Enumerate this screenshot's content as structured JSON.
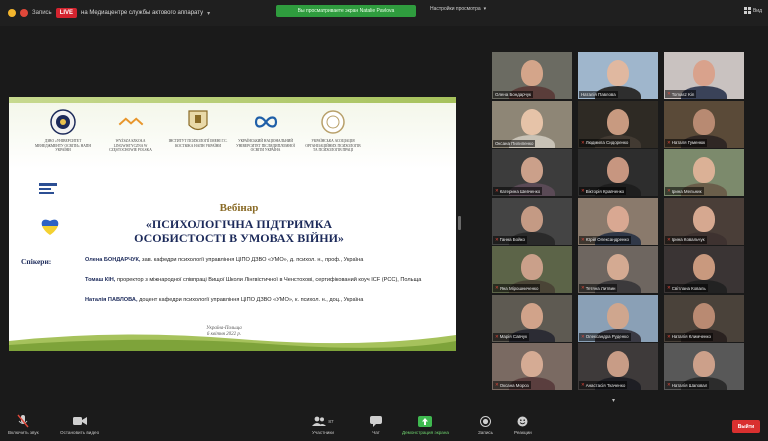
{
  "topbar": {
    "live_label": "LIVE",
    "recording_label": "Запись",
    "channel": "на Медиацентре службы актового аппарату",
    "banner": "Вы просматриваете экран Natalie Pavlova",
    "view_options": "Настройки просмотра",
    "view_button": "Вид"
  },
  "slide": {
    "logos": [
      {
        "caption": "ДЗВО «УНІВЕРСИТЕТ МЕНЕДЖМЕНТУ ОСВІТИ» НАПН УКРАЇНИ"
      },
      {
        "caption": "WYŻSZA SZKOŁA LINGWISTYCZNA W CZĘSTOCHOWIE POLSKA"
      },
      {
        "caption": "ІНСТИТУТ ПСИХОЛОГІЇ ІМЕНІ Г.С. КОСТЮКА НАПН УКРАЇНИ"
      },
      {
        "caption": "УКРАЇНСЬКИЙ НАЦІОНАЛЬНИЙ УНІВЕРСИТЕТ ПІСЛЯДИПЛОМНОЇ ОСВІТИ УКРАЇНА"
      },
      {
        "caption": "УКРАЇНСЬКА АСОЦІАЦІЯ ОРГАНІЗАЦІЙНИХ ПСИХОЛОГІВ ТА ПСИХОЛОГІВ ПРАЦІ"
      }
    ],
    "heading": "Вебінар",
    "title_line1": "«ПСИХОЛОГІЧНА ПІДТРИМКА",
    "title_line2": "ОСОБИСТОСТІ В УМОВАХ ВІЙНИ»",
    "speakers_label": "Спікери:",
    "speakers": [
      {
        "name": "Олена БОНДАРЧУК,",
        "desc": "зав. кафедри психології управління ЦІПО ДЗВО «УМО», д. психол. н., проф., Україна"
      },
      {
        "name": "Томаш КІН,",
        "desc": "проректор з міжнародної співпраці Вищої Школи Лінгвістичної в Ченстохові, сертифікований коуч ICF (PCC), Польща"
      },
      {
        "name": "Наталія ПАВЛОВА,",
        "desc": "доцент кафедри психології управління ЦІПО ДЗВО «УМО», к. психол. н., доц., Україна"
      }
    ],
    "place": "Україна-Польща",
    "date": "6 квітня 2022 р."
  },
  "gallery": [
    {
      "name": "Олена Бондарчук",
      "muted": false,
      "active": false,
      "bg": "#6b6b62",
      "skin": "#d4a58a",
      "cloth": "#5a3d3a"
    },
    {
      "name": "Наталія Павлова",
      "muted": false,
      "active": false,
      "bg": "#9fb6cc",
      "skin": "#e0b8a0",
      "cloth": "#2e2e2e"
    },
    {
      "name": "Tomasz Kin",
      "muted": true,
      "active": false,
      "bg": "#c9c2c0",
      "skin": "#d9a28c",
      "cloth": "#3a4258"
    },
    {
      "name": "Оксана Пилипенко",
      "muted": false,
      "active": true,
      "bg": "#8e8676",
      "skin": "#e6c3a8",
      "cloth": "#c8c2b6"
    },
    {
      "name": "Людмила Сидоренко",
      "muted": true,
      "active": false,
      "bg": "#2e2a24",
      "skin": "#c89a80",
      "cloth": "#423a32"
    },
    {
      "name": "Наталя Гуменюк",
      "muted": true,
      "active": false,
      "bg": "#5a4a38",
      "skin": "#b88a72",
      "cloth": "#2f2724"
    },
    {
      "name": "Катерина Шевченко",
      "muted": true,
      "active": false,
      "bg": "#3c3c3c",
      "skin": "#cba08a",
      "cloth": "#5a4a56"
    },
    {
      "name": "Вікторія Кравченко",
      "muted": true,
      "active": false,
      "bg": "#2d2d2d",
      "skin": "#c79680",
      "cloth": "#1e1e1e"
    },
    {
      "name": "Ірина Мельник",
      "muted": true,
      "active": false,
      "bg": "#7c8a6c",
      "skin": "#dbb196",
      "cloth": "#6a5e4a"
    },
    {
      "name": "Ганна Бойко",
      "muted": true,
      "active": false,
      "bg": "#444",
      "skin": "#c49a84",
      "cloth": "#2a2a2a"
    },
    {
      "name": "Юрій Олександренко",
      "muted": true,
      "active": false,
      "bg": "#8a7a6c",
      "skin": "#d9a892",
      "cloth": "#303848"
    },
    {
      "name": "Ірина Ковальчук",
      "muted": true,
      "active": false,
      "bg": "#4a3e38",
      "skin": "#d6a890",
      "cloth": "#3e3230"
    },
    {
      "name": "Яна Мірошниченко",
      "muted": true,
      "active": false,
      "bg": "#5c6448",
      "skin": "#caa08a",
      "cloth": "#4a4436"
    },
    {
      "name": "Тетяна Литвин",
      "muted": true,
      "active": false,
      "bg": "#6e6660",
      "skin": "#d4aa92",
      "cloth": "#3c3a3c"
    },
    {
      "name": "Світлана Коваль",
      "muted": true,
      "active": false,
      "bg": "#3a3434",
      "skin": "#c9997e",
      "cloth": "#222"
    },
    {
      "name": "Марія Савчук",
      "muted": true,
      "active": false,
      "bg": "#5e5a52",
      "skin": "#d1a38a",
      "cloth": "#2c2c34"
    },
    {
      "name": "Олександра Руденко",
      "muted": true,
      "active": false,
      "bg": "#8aa0b6",
      "skin": "#cfa68e",
      "cloth": "#3a3a44"
    },
    {
      "name": "Наталія Климченко",
      "muted": true,
      "active": false,
      "bg": "#4a423a",
      "skin": "#b98a72",
      "cloth": "#2a2220"
    },
    {
      "name": "Оксана Мороз",
      "muted": true,
      "active": false,
      "bg": "#7a6a62",
      "skin": "#d5ab94",
      "cloth": "#5a3e3e"
    },
    {
      "name": "Анастасія Ткаченко",
      "muted": true,
      "active": false,
      "bg": "#3e3a3a",
      "skin": "#c89c86",
      "cloth": "#1e1e24"
    },
    {
      "name": "Наталія Шаповал",
      "muted": true,
      "active": false,
      "bg": "#585858",
      "skin": "#ccA08a",
      "cloth": "#2c2c2c"
    }
  ],
  "toolbar": {
    "mute": "Включить звук",
    "video": "Остановить видео",
    "participants": "Участники",
    "participants_count": "87",
    "chat": "Чат",
    "share": "Демонстрация экрана",
    "record": "Запись",
    "reactions": "Реакции",
    "end": "Выйти"
  },
  "colors": {
    "accent_green": "#2f9c3e",
    "live_red": "#d3242f",
    "title_navy": "#1c2a5a",
    "active_speaker": "#e6d84a"
  }
}
